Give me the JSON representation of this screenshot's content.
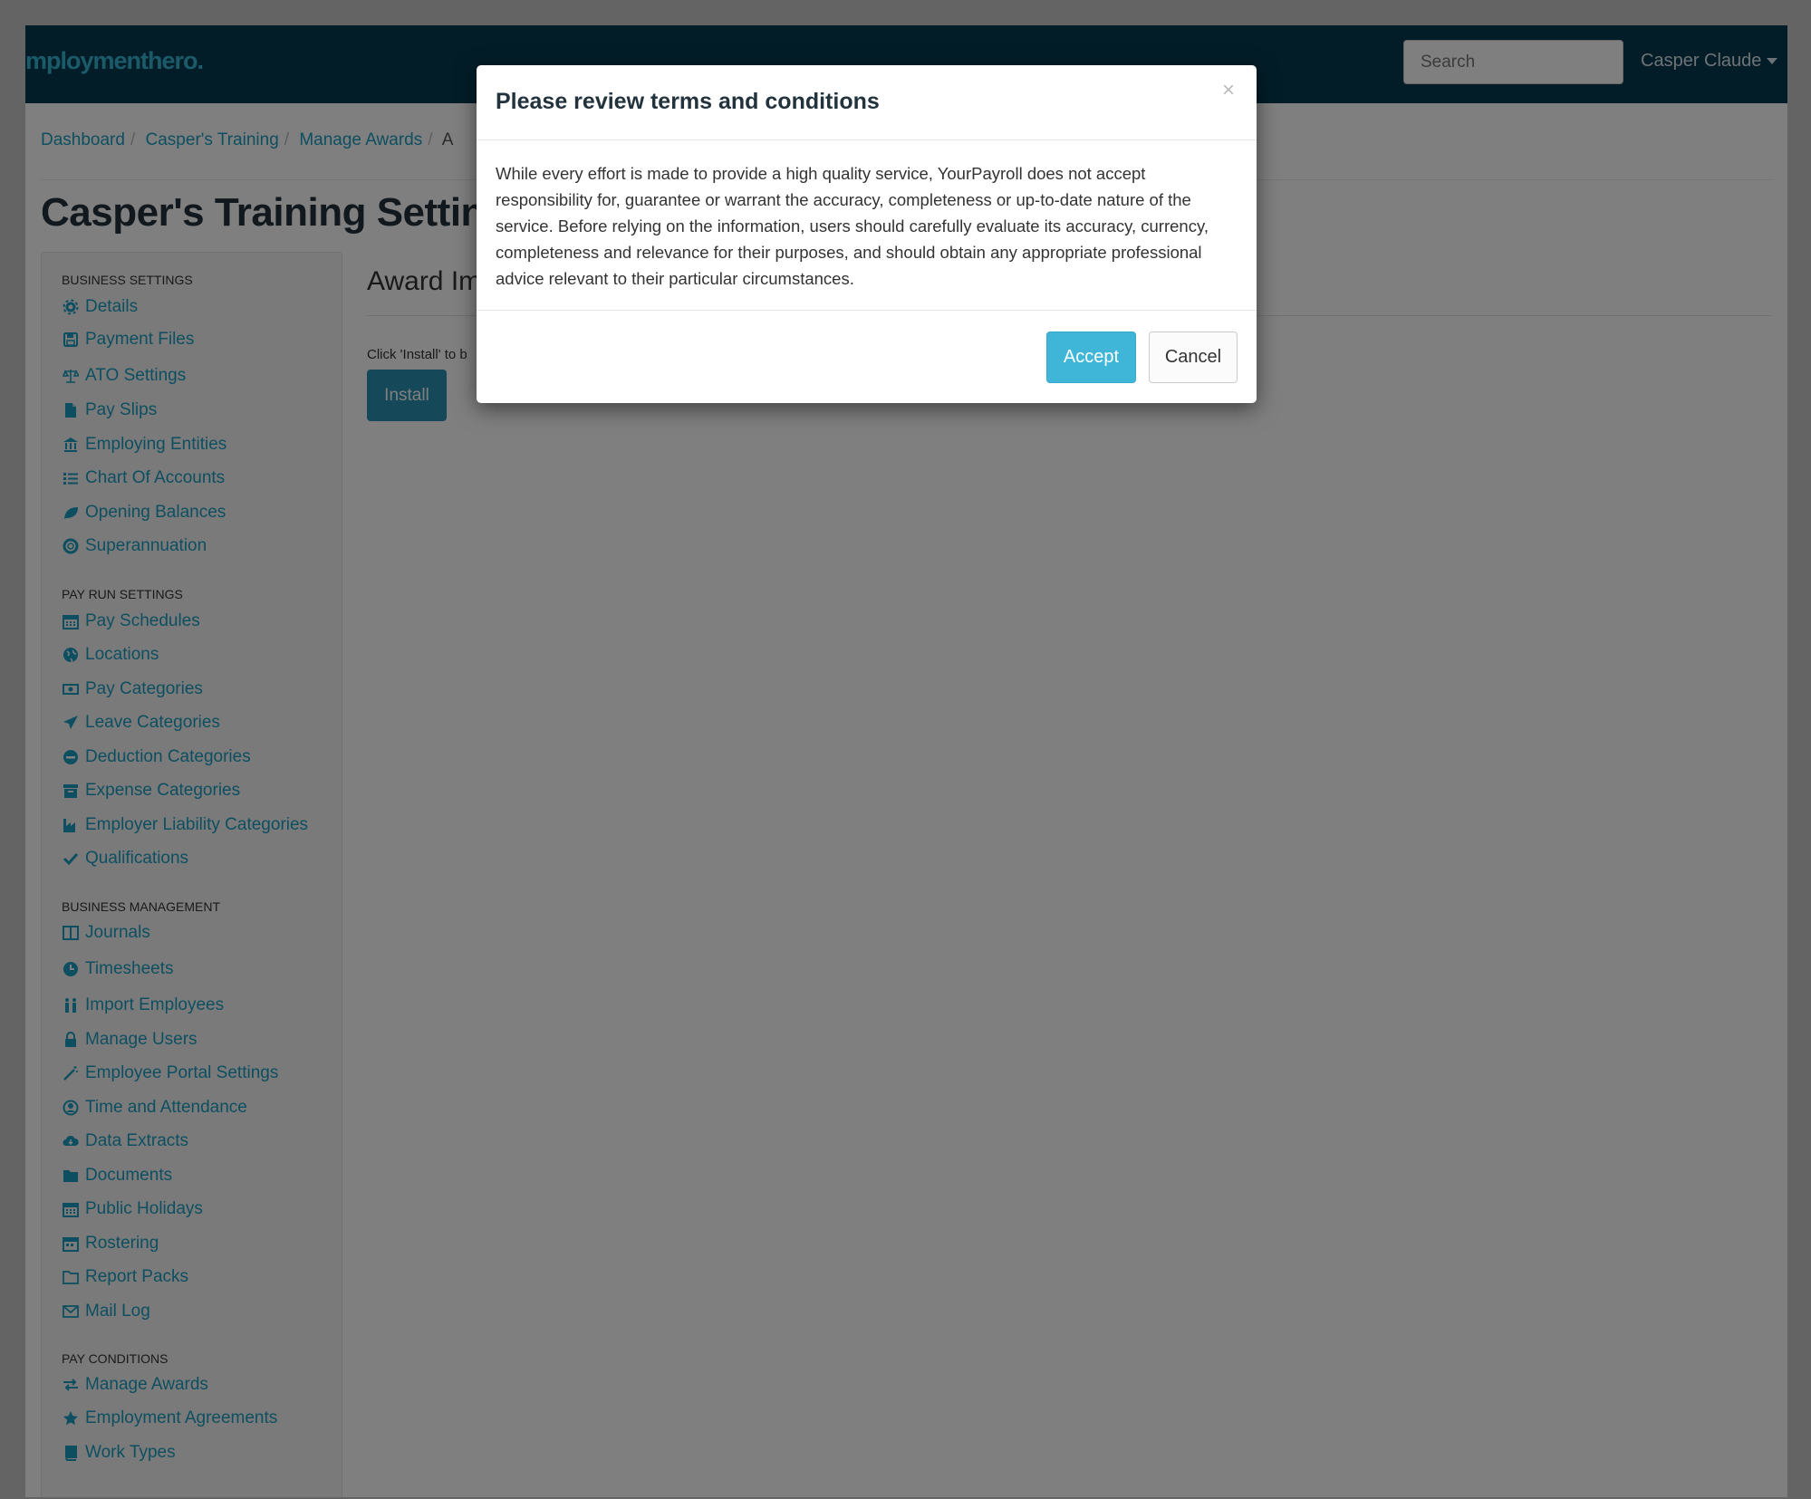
{
  "navbar": {
    "logo": "mploymenthero.",
    "search_placeholder": "Search",
    "user_name": "Casper Claude"
  },
  "breadcrumb": {
    "items": [
      "Dashboard",
      "Casper's Training",
      "Manage Awards"
    ],
    "current": "A"
  },
  "page": {
    "title": "Casper's Training Settings"
  },
  "sidebar": {
    "sections": [
      {
        "title": "BUSINESS SETTINGS",
        "items": [
          {
            "label": "Details",
            "icon": "gear-icon"
          },
          {
            "label": "Payment Files",
            "icon": "floppy-disk-icon"
          },
          {
            "label": "ATO Settings",
            "icon": "scales-icon"
          },
          {
            "label": "Pay Slips",
            "icon": "file-icon"
          },
          {
            "label": "Employing Entities",
            "icon": "bank-icon"
          },
          {
            "label": "Chart Of Accounts",
            "icon": "list-icon"
          },
          {
            "label": "Opening Balances",
            "icon": "leaf-icon"
          },
          {
            "label": "Superannuation",
            "icon": "life-ring-icon"
          }
        ]
      },
      {
        "title": "PAY RUN SETTINGS",
        "items": [
          {
            "label": "Pay Schedules",
            "icon": "calendar-icon"
          },
          {
            "label": "Locations",
            "icon": "globe-icon"
          },
          {
            "label": "Pay Categories",
            "icon": "money-icon"
          },
          {
            "label": "Leave Categories",
            "icon": "plane-icon"
          },
          {
            "label": "Deduction Categories",
            "icon": "minus-circle-icon"
          },
          {
            "label": "Expense Categories",
            "icon": "archive-icon"
          },
          {
            "label": "Employer Liability Categories",
            "icon": "industry-icon"
          },
          {
            "label": "Qualifications",
            "icon": "check-icon"
          }
        ]
      },
      {
        "title": "BUSINESS MANAGEMENT",
        "items": [
          {
            "label": "Journals",
            "icon": "columns-icon"
          },
          {
            "label": "Timesheets",
            "icon": "clock-icon"
          },
          {
            "label": "Import Employees",
            "icon": "people-icon"
          },
          {
            "label": "Manage Users",
            "icon": "lock-icon"
          },
          {
            "label": "Employee Portal Settings",
            "icon": "magic-wand-icon"
          },
          {
            "label": "Time and Attendance",
            "icon": "user-circle-icon"
          },
          {
            "label": "Data Extracts",
            "icon": "cloud-download-icon"
          },
          {
            "label": "Documents",
            "icon": "folder-icon"
          },
          {
            "label": "Public Holidays",
            "icon": "calendar-icon"
          },
          {
            "label": "Rostering",
            "icon": "calendar-grid-icon"
          },
          {
            "label": "Report Packs",
            "icon": "folder-open-icon"
          },
          {
            "label": "Mail Log",
            "icon": "envelope-icon"
          }
        ]
      },
      {
        "title": "PAY CONDITIONS",
        "items": [
          {
            "label": "Manage Awards",
            "icon": "exchange-icon"
          },
          {
            "label": "Employment Agreements",
            "icon": "star-icon"
          },
          {
            "label": "Work Types",
            "icon": "book-icon"
          }
        ]
      }
    ]
  },
  "main": {
    "heading": "Award Im",
    "hint": "Click 'Install' to b",
    "install_label": "Install"
  },
  "modal": {
    "title": "Please review terms and conditions",
    "close_label": "×",
    "body": "While every effort is made to provide a high quality service, YourPayroll does not accept responsibility for, guarantee or warrant the accuracy, completeness or up-to-date nature of the service. Before relying on the information, users should carefully evaluate its accuracy, currency, completeness and relevance for their purposes, and should obtain any appropriate professional advice relevant to their particular circumstances.",
    "accept_label": "Accept",
    "cancel_label": "Cancel"
  },
  "colors": {
    "navbar_bg": "#073b50",
    "link": "#1a9fc0",
    "accept_bg": "#3fb6d7",
    "install_bg": "#2a92b3"
  }
}
